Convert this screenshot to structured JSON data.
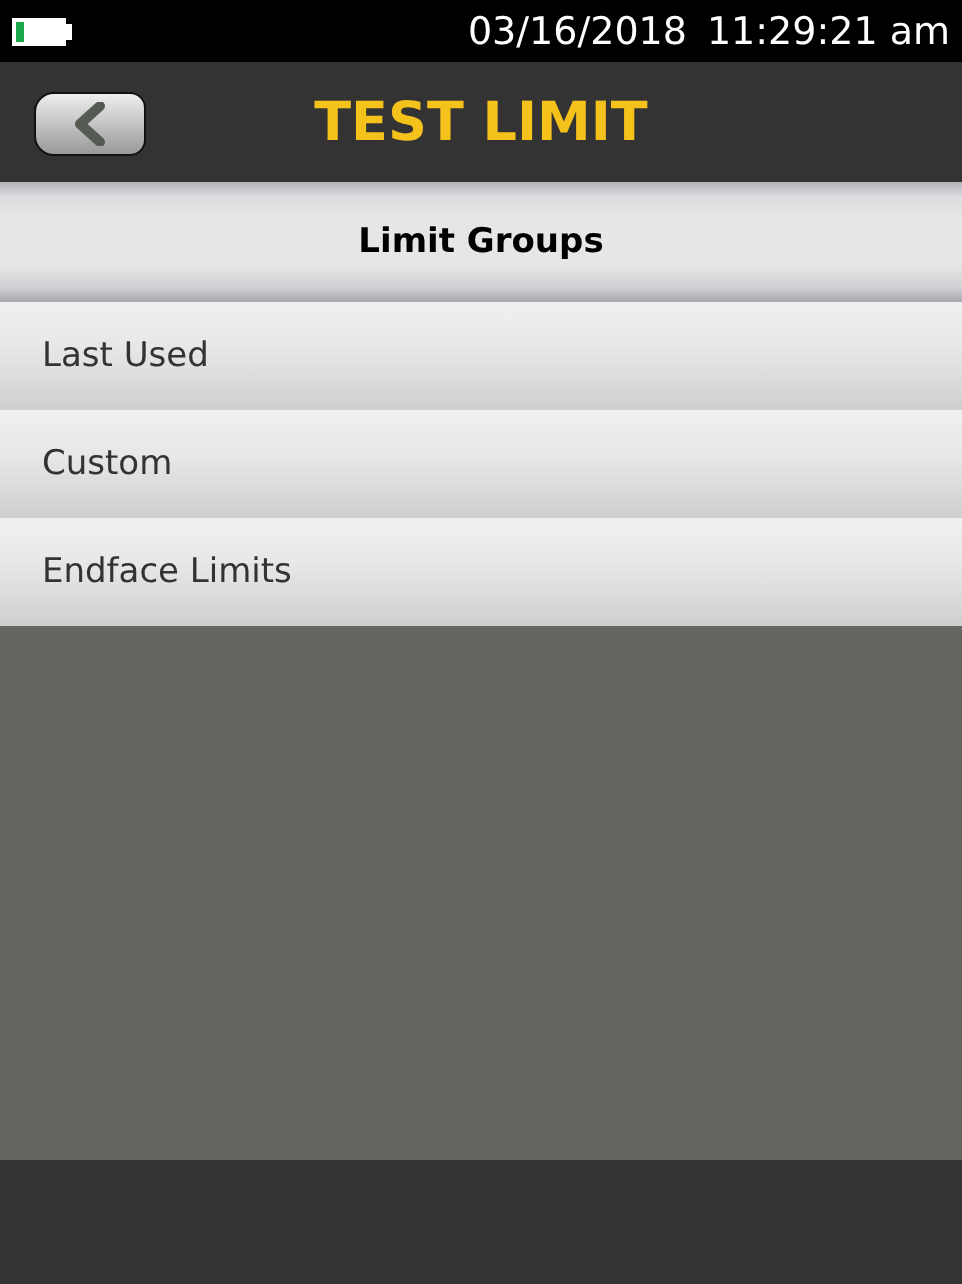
{
  "status_bar": {
    "date": "03/16/2018",
    "time": "11:29:21 am"
  },
  "title_bar": {
    "title": "TEST LIMIT"
  },
  "section": {
    "title": "Limit Groups"
  },
  "items": [
    {
      "label": "Last Used"
    },
    {
      "label": "Custom"
    },
    {
      "label": "Endface Limits"
    }
  ]
}
